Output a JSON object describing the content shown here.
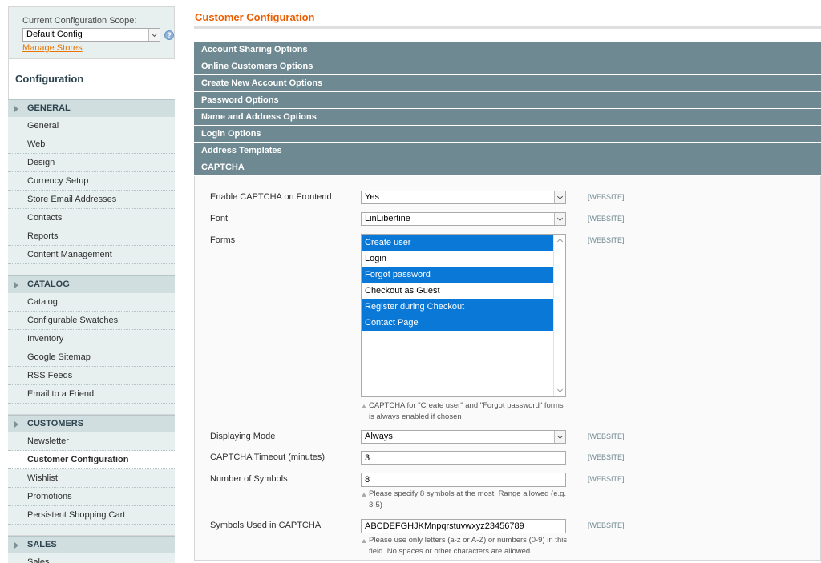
{
  "sidebar": {
    "scope_label": "Current Configuration Scope:",
    "scope_value": "Default Config",
    "manage_stores": "Manage Stores",
    "title": "Configuration",
    "groups": [
      {
        "label": "GENERAL",
        "items": [
          "General",
          "Web",
          "Design",
          "Currency Setup",
          "Store Email Addresses",
          "Contacts",
          "Reports",
          "Content Management"
        ]
      },
      {
        "label": "CATALOG",
        "items": [
          "Catalog",
          "Configurable Swatches",
          "Inventory",
          "Google Sitemap",
          "RSS Feeds",
          "Email to a Friend"
        ]
      },
      {
        "label": "CUSTOMERS",
        "items": [
          "Newsletter",
          "Customer Configuration",
          "Wishlist",
          "Promotions",
          "Persistent Shopping Cart"
        ]
      },
      {
        "label": "SALES",
        "items": [
          "Sales"
        ]
      }
    ],
    "active_item": "Customer Configuration"
  },
  "main": {
    "title": "Customer Configuration",
    "sections": [
      "Account Sharing Options",
      "Online Customers Options",
      "Create New Account Options",
      "Password Options",
      "Name and Address Options",
      "Login Options",
      "Address Templates",
      "CAPTCHA"
    ],
    "captcha": {
      "enable_label": "Enable CAPTCHA on Frontend",
      "enable_value": "Yes",
      "font_label": "Font",
      "font_value": "LinLibertine",
      "forms_label": "Forms",
      "forms_options": [
        {
          "label": "Create user",
          "selected": true
        },
        {
          "label": "Login",
          "selected": false
        },
        {
          "label": "Forgot password",
          "selected": true
        },
        {
          "label": "Checkout as Guest",
          "selected": false
        },
        {
          "label": "Register during Checkout",
          "selected": true
        },
        {
          "label": "Contact Page",
          "selected": true
        }
      ],
      "forms_note": "CAPTCHA for \"Create user\" and \"Forgot password\" forms is always enabled if chosen",
      "mode_label": "Displaying Mode",
      "mode_value": "Always",
      "timeout_label": "CAPTCHA Timeout (minutes)",
      "timeout_value": "3",
      "symbols_label": "Number of Symbols",
      "symbols_value": "8",
      "symbols_note": "Please specify 8 symbols at the most. Range allowed (e.g. 3-5)",
      "used_label": "Symbols Used in CAPTCHA",
      "used_value": "ABCDEFGHJKMnpqrstuvwxyz23456789",
      "used_note": "Please use only letters (a-z or A-Z) or numbers (0-9) in this field. No spaces or other characters are allowed.",
      "scope_tag": "[WEBSITE]"
    }
  }
}
